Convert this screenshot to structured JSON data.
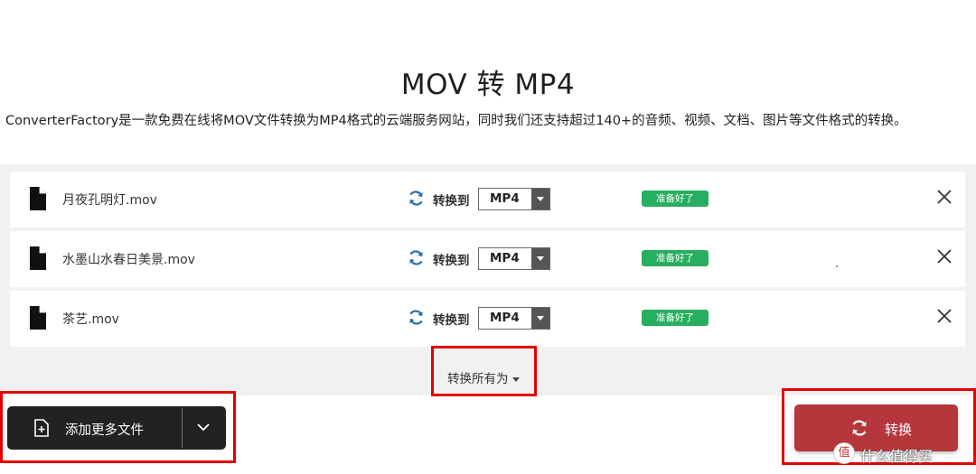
{
  "page": {
    "title": "MOV 转 MP4",
    "subtitle": "ConverterFactory是一款免费在线将MOV文件转换为MP4格式的云端服务网站，同时我们还支持超过140+的音频、视频、文档、图片等文件格式的转换。"
  },
  "files": [
    {
      "name": "月夜孔明灯.mov",
      "convert_label": "转换到",
      "format": "MP4",
      "status": "准备好了"
    },
    {
      "name": "水墨山水春日美景.mov",
      "convert_label": "转换到",
      "format": "MP4",
      "status": "准备好了"
    },
    {
      "name": "茶艺.mov",
      "convert_label": "转换到",
      "format": "MP4",
      "status": "准备好了"
    }
  ],
  "convert_all": {
    "label": "转换所有为"
  },
  "add_files": {
    "label": "添加更多文件"
  },
  "convert_button": {
    "label": "转换"
  },
  "watermark": {
    "logo": "值",
    "text": "什么值得买"
  },
  "icons": {
    "file": "file-icon",
    "sync": "sync-icon",
    "remove": "close-icon",
    "add_file": "file-plus-icon",
    "dropdown": "chevron-down-icon"
  },
  "colors": {
    "ready_badge": "#27ae60",
    "convert_button": "#b5373c",
    "add_button": "#222222",
    "highlight": "#e30000",
    "sync_icon": "#2a6fb0"
  }
}
